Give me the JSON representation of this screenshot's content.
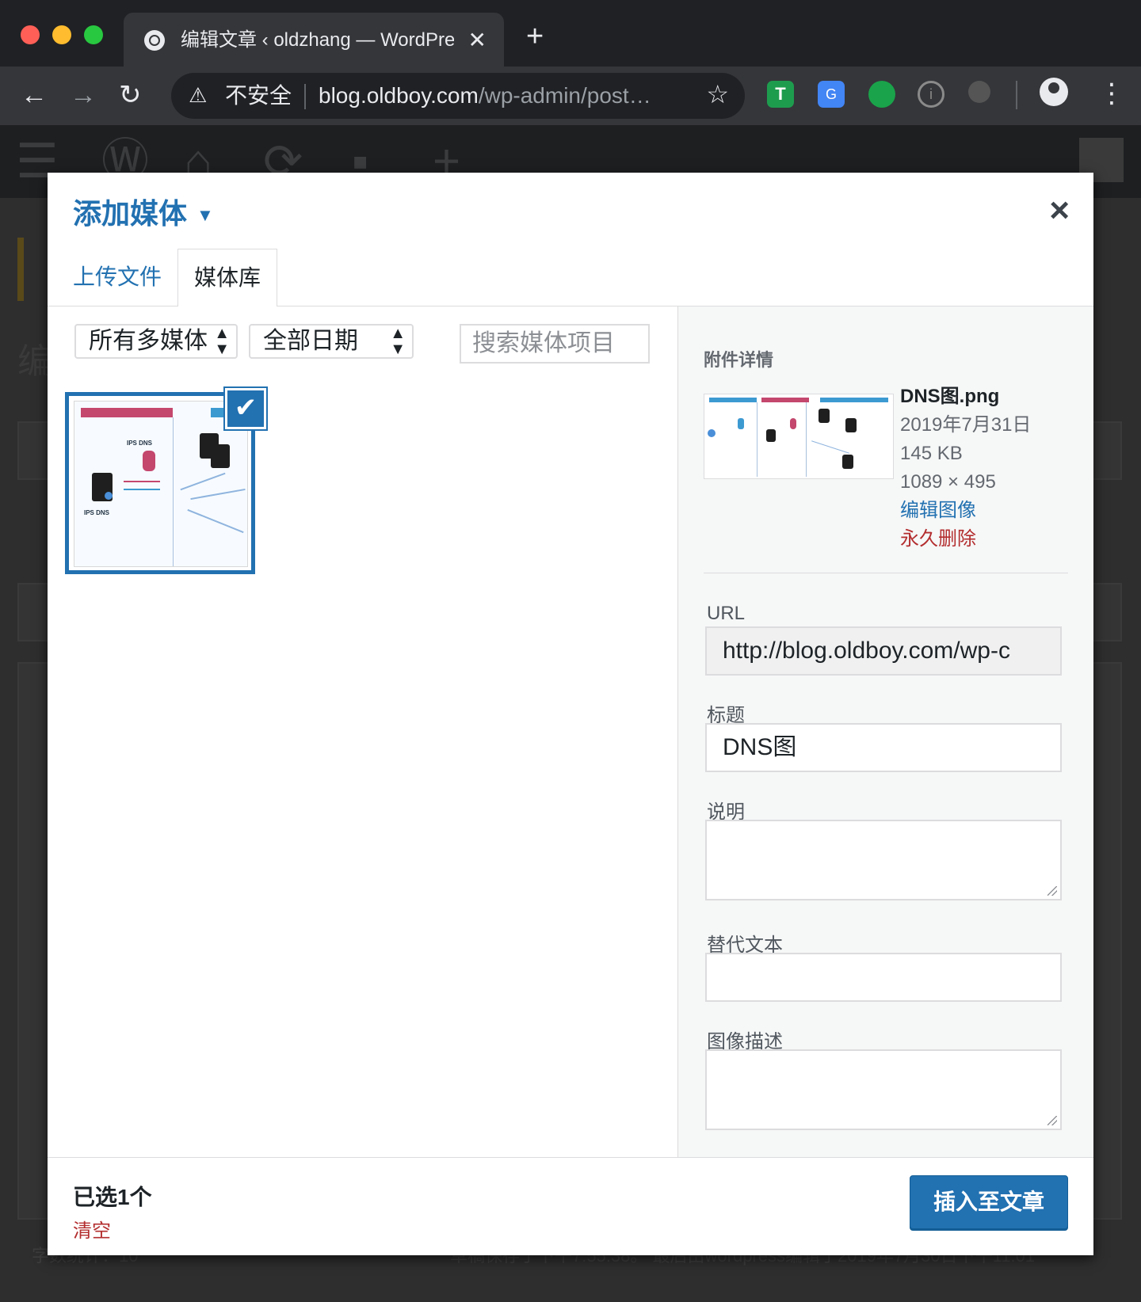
{
  "browser": {
    "tab_title": "编辑文章 ‹ oldzhang — WordPress",
    "tab_close": "✕",
    "new_tab": "+",
    "security_label": "不安全",
    "url_host": "blog.oldboy.com",
    "url_path": "/wp-admin/post…",
    "ext_icons": [
      "toolbox-extension-icon",
      "google-translate-icon",
      "evernote-icon",
      "info-extension-icon",
      "key-extension-icon"
    ]
  },
  "wp_background": {
    "edit_heading_fragment": "编",
    "footer_left": "字数统计：10",
    "footer_right": "草稿保存于下午7:55:38。 最后由wordpress编辑于2019年7月30日下午11:01"
  },
  "modal": {
    "title": "添加媒体",
    "close": "×",
    "tabs": [
      {
        "label": "上传文件",
        "active": false
      },
      {
        "label": "媒体库",
        "active": true
      }
    ],
    "filters": {
      "type_selected": "所有多媒体",
      "date_selected": "全部日期",
      "search_placeholder": "搜索媒体项目"
    },
    "details": {
      "heading": "附件详情",
      "filename": "DNS图.png",
      "date": "2019年7月31日",
      "size": "145 KB",
      "dimensions": "1089 × 495",
      "edit_link": "编辑图像",
      "delete_link": "永久删除",
      "url_label": "URL",
      "url_value": "http://blog.oldboy.com/wp-c",
      "title_label": "标题",
      "title_value": "DNS图",
      "caption_label": "说明",
      "caption_value": "",
      "alt_label": "替代文本",
      "alt_value": "",
      "description_label": "图像描述",
      "description_value": ""
    },
    "footer": {
      "selection_count": "已选1个",
      "clear_label": "清空",
      "insert_button": "插入至文章"
    }
  },
  "colors": {
    "accent": "#2271b1",
    "danger": "#b32d2e"
  }
}
